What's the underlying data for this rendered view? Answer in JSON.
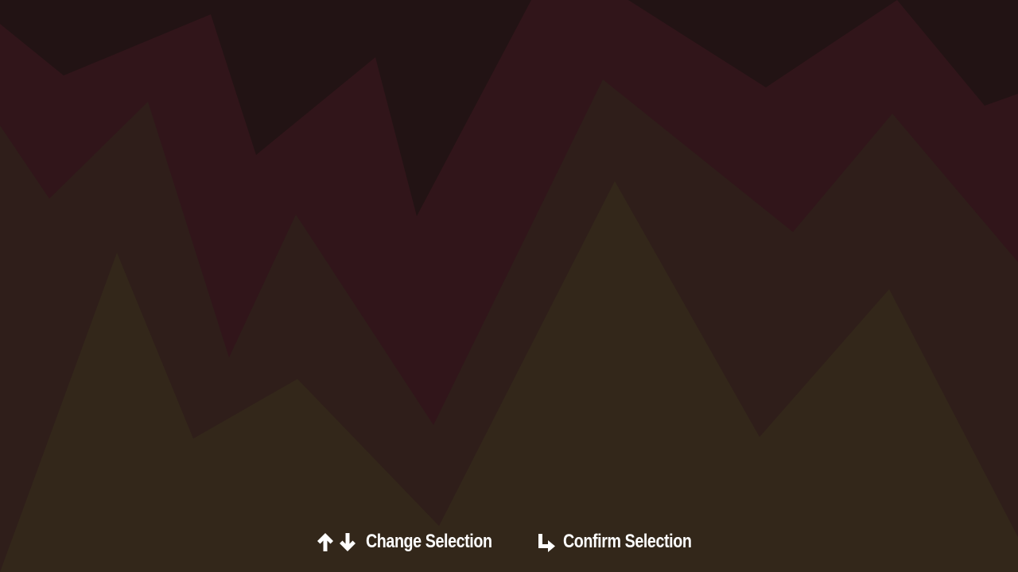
{
  "colors": {
    "background_top": "#221314",
    "band_crimson": "#31151a",
    "band_brown": "#2f1e1a",
    "band_olive": "#33271a",
    "text": "#ffffff"
  },
  "hints": {
    "change": {
      "icons": [
        "arrow-up-icon",
        "arrow-down-icon"
      ],
      "label": "Change Selection"
    },
    "confirm": {
      "icons": [
        "enter-return-icon"
      ],
      "label": "Confirm Selection"
    }
  }
}
